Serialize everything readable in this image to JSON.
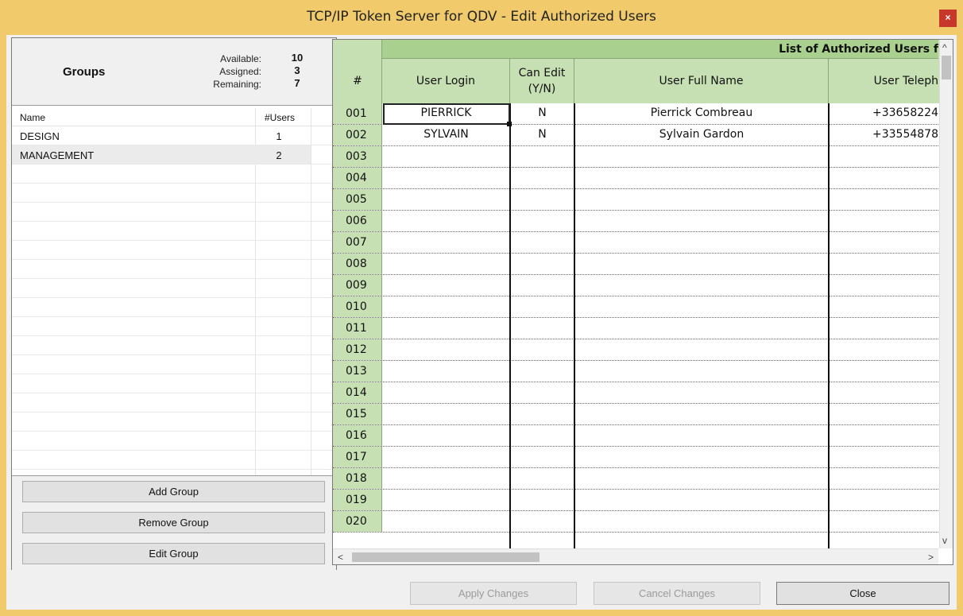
{
  "window": {
    "title": "TCP/IP Token Server for QDV - Edit Authorized Users",
    "close_glyph": "×"
  },
  "groups": {
    "title": "Groups",
    "stats": [
      {
        "label": "Available:",
        "value": "10"
      },
      {
        "label": "Assigned:",
        "value": "3"
      },
      {
        "label": "Remaining:",
        "value": "7"
      }
    ],
    "columns": {
      "name": "Name",
      "users": "#Users"
    },
    "rows": [
      {
        "name": "DESIGN",
        "users": "1"
      },
      {
        "name": "MANAGEMENT",
        "users": "2"
      }
    ],
    "buttons": {
      "add": "Add Group",
      "remove": "Remove Group",
      "edit": "Edit Group"
    }
  },
  "users_grid": {
    "banner": "List of Authorized Users f",
    "columns": {
      "hash": "#",
      "login": "User Login",
      "can_edit": "Can Edit (Y/N)",
      "full_name": "User Full Name",
      "telephone": "User Teleph"
    },
    "row_numbers": [
      "001",
      "002",
      "003",
      "004",
      "005",
      "006",
      "007",
      "008",
      "009",
      "010",
      "011",
      "012",
      "013",
      "014",
      "015",
      "016",
      "017",
      "018",
      "019",
      "020"
    ],
    "rows": [
      {
        "login": "PIERRICK",
        "can_edit": "N",
        "full_name": "Pierrick Combreau",
        "telephone": "+33658224"
      },
      {
        "login": "SYLVAIN",
        "can_edit": "N",
        "full_name": "Sylvain Gardon",
        "telephone": "+33554878"
      }
    ]
  },
  "footer": {
    "apply": "Apply Changes",
    "cancel": "Cancel Changes",
    "close": "Close"
  },
  "glyphs": {
    "up": "^",
    "down": "v",
    "left": "<",
    "right": ">"
  }
}
